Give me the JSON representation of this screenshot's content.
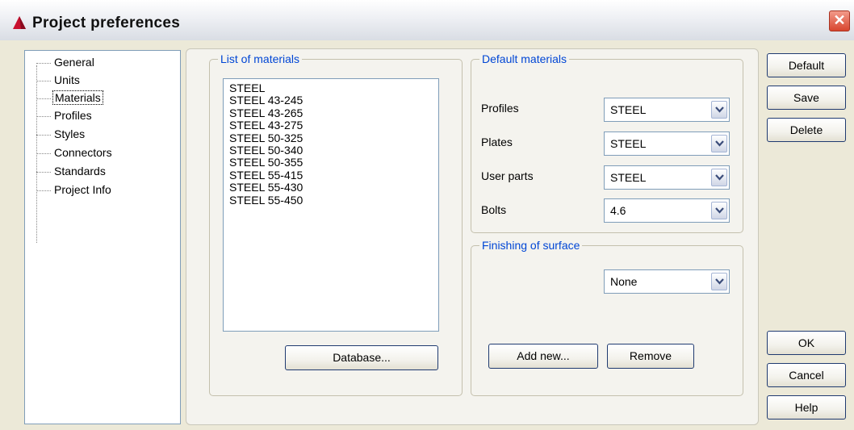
{
  "window": {
    "title": "Project preferences",
    "close_label": "✕"
  },
  "tree": {
    "items": [
      {
        "label": "General"
      },
      {
        "label": "Units"
      },
      {
        "label": "Materials"
      },
      {
        "label": "Profiles"
      },
      {
        "label": "Styles"
      },
      {
        "label": "Connectors"
      },
      {
        "label": "Standards"
      },
      {
        "label": "Project Info"
      }
    ],
    "selected": "Materials"
  },
  "materials_list": {
    "title": "List of materials",
    "items": [
      "STEEL",
      "STEEL 43-245",
      "STEEL 43-265",
      "STEEL 43-275",
      "STEEL 50-325",
      "STEEL 50-340",
      "STEEL 50-355",
      "STEEL 55-415",
      "STEEL 55-430",
      "STEEL 55-450"
    ],
    "database_label": "Database..."
  },
  "default_materials": {
    "title": "Default materials",
    "rows": [
      {
        "label": "Profiles",
        "value": "STEEL"
      },
      {
        "label": "Plates",
        "value": "STEEL"
      },
      {
        "label": "User parts",
        "value": "STEEL"
      },
      {
        "label": "Bolts",
        "value": "4.6"
      }
    ]
  },
  "finishing": {
    "title": "Finishing of surface",
    "value": "None",
    "add_label": "Add new...",
    "remove_label": "Remove"
  },
  "side_buttons": {
    "default_label": "Default",
    "save_label": "Save",
    "delete_label": "Delete",
    "ok_label": "OK",
    "cancel_label": "Cancel",
    "help_label": "Help"
  }
}
